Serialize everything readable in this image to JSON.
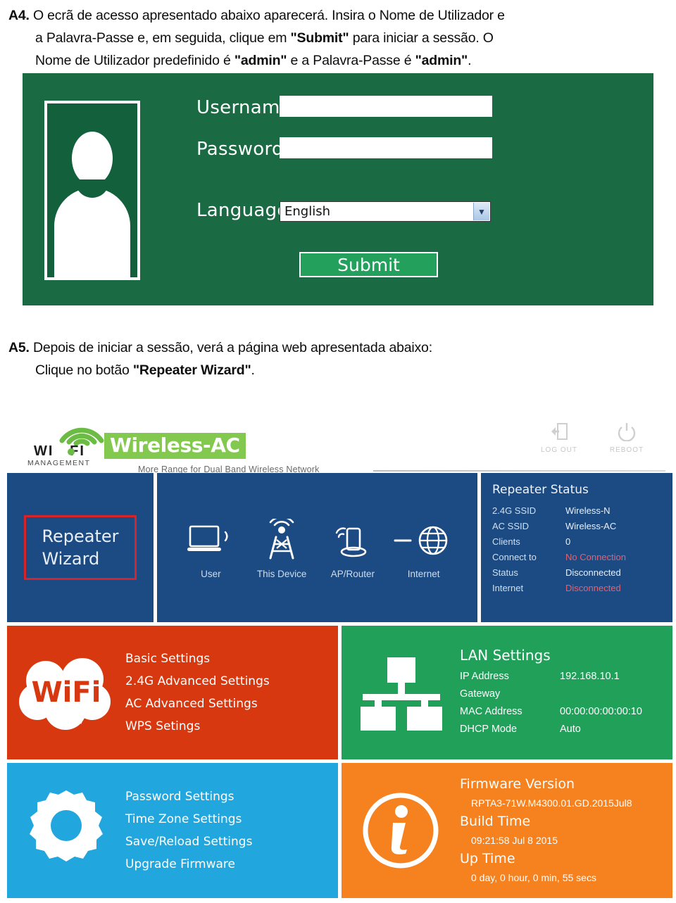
{
  "instructions": {
    "a4": {
      "marker": "A4.",
      "line1": "O ecrã de acesso apresentado abaixo aparecerá. Insira o Nome de Utilizador e",
      "line2_pre": "a Palavra-Passe e, em seguida, clique em ",
      "line2_bold": "\"Submit\"",
      "line2_post": " para iniciar a sessão. O",
      "line3_pre": "Nome de Utilizador predefinido é ",
      "line3_bold1": "\"admin\"",
      "line3_mid": " e a Palavra-Passe é ",
      "line3_bold2": "\"admin\"",
      "line3_post": "."
    },
    "a5": {
      "marker": "A5.",
      "line1": "Depois de iniciar a sessão, verá a página web apresentada abaixo:",
      "line2_pre": "Clique no botão ",
      "line2_bold": "\"Repeater Wizard\"",
      "line2_post": "."
    }
  },
  "login": {
    "username_label": "Username",
    "password_label": "Password",
    "language_label": "Language",
    "username_value": "",
    "password_value": "",
    "language_value": "English",
    "submit_label": "Submit",
    "panel_color": "#1a6b44",
    "submit_color": "#22a05c"
  },
  "router": {
    "brand": {
      "wifi_left": "WI",
      "wifi_right": "FI",
      "management": "MANAGEMENT",
      "product": "Wireless-AC",
      "tagline": "More Range for Dual Band Wireless Network",
      "accent_green": "#84c94f"
    },
    "header_actions": [
      {
        "label": "LOG OUT",
        "icon": "logout-icon"
      },
      {
        "label": "REBOOT",
        "icon": "power-icon"
      }
    ],
    "wizard": {
      "line1": "Repeater",
      "line2": "Wizard",
      "highlight_color": "#d8232a"
    },
    "topology": {
      "nodes": [
        {
          "label": "User",
          "icon": "laptop-icon"
        },
        {
          "label": "This Device",
          "icon": "antenna-tower-icon"
        },
        {
          "label": "AP/Router",
          "icon": "router-icon"
        },
        {
          "label": "Internet",
          "icon": "globe-icon"
        }
      ]
    },
    "repeater_status": {
      "title": "Repeater Status",
      "rows": [
        {
          "key": "2.4G SSID",
          "value": "Wireless-N",
          "alert": false
        },
        {
          "key": "AC SSID",
          "value": "Wireless-AC",
          "alert": false
        },
        {
          "key": "Clients",
          "value": "0",
          "alert": false
        },
        {
          "key": "Connect to",
          "value": "No Connection",
          "alert": true
        },
        {
          "key": "Status",
          "value": "Disconnected",
          "alert": false
        },
        {
          "key": "Internet",
          "value": "Disconnected",
          "alert": true
        }
      ],
      "alert_color": "#e4606d"
    },
    "wifi_panel": {
      "logo_text": "WiFi",
      "items": [
        "Basic Settings",
        "2.4G Advanced Settings",
        "AC Advanced Settings",
        "WPS Setings"
      ],
      "color": "#d8380f"
    },
    "lan_panel": {
      "title": "LAN Settings",
      "rows": [
        {
          "key": "IP Address",
          "value": "192.168.10.1"
        },
        {
          "key": "Gateway",
          "value": ""
        },
        {
          "key": "MAC Address",
          "value": "00:00:00:00:00:10"
        },
        {
          "key": "DHCP Mode",
          "value": "Auto"
        }
      ],
      "color": "#21a05a"
    },
    "settings_panel": {
      "items": [
        "Password Settings",
        "Time Zone Settings",
        "Save/Reload Settings",
        "Upgrade Firmware"
      ],
      "color": "#22a6de"
    },
    "info_panel": {
      "firmware_label": "Firmware Version",
      "firmware_value": "RPTA3-71W.M4300.01.GD.2015Jul8",
      "build_label": "Build Time",
      "build_value": "09:21:58 Jul 8 2015",
      "uptime_label": "Up Time",
      "uptime_value": "0 day, 0 hour, 0 min, 55 secs",
      "color": "#f5811f"
    }
  }
}
